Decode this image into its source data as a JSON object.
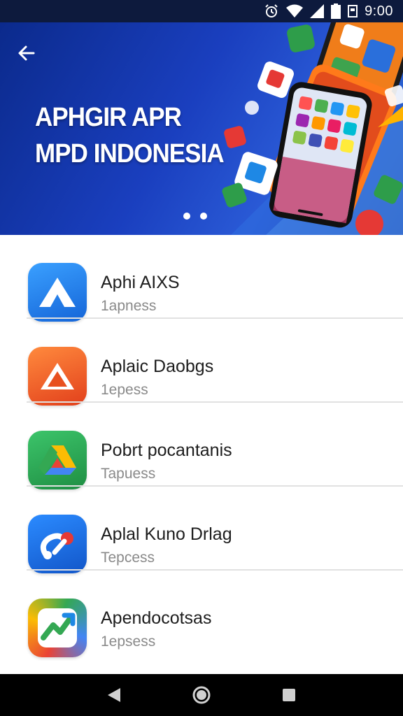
{
  "status_bar": {
    "time": "9:00",
    "icons": [
      "alarm-icon",
      "wifi-icon",
      "signal-icon",
      "battery-icon",
      "notification-icon"
    ]
  },
  "hero": {
    "title_line1": "APHGIR APR",
    "title_line2": "MPD INDONESIA",
    "back_icon": "back-arrow-icon",
    "page_dots": 2
  },
  "apps": [
    {
      "name": "Aphi AIXS",
      "subtitle": "1apness",
      "icon": "blue-a-icon",
      "color": "#1e88e5"
    },
    {
      "name": "Aplaic Daobgs",
      "subtitle": "1epess",
      "icon": "orange-a-icon",
      "color": "#f4511e"
    },
    {
      "name": "Pobrt pocantanis",
      "subtitle": "Tapuess",
      "icon": "drive-icon",
      "color": "#2e9d4a"
    },
    {
      "name": "Aplal Kuno Drlag",
      "subtitle": "Tepcess",
      "icon": "blue-loop-icon",
      "color": "#1a6fd8"
    },
    {
      "name": "Apendocotsas",
      "subtitle": "1epsess",
      "icon": "colorful-arrow-icon",
      "color": "#34a853"
    }
  ],
  "nav": {
    "back": "nav-back-icon",
    "home": "nav-home-icon",
    "recents": "nav-recents-icon"
  }
}
